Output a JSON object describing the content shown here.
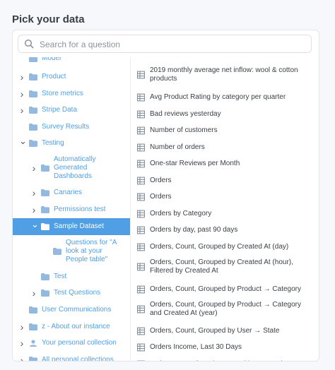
{
  "page": {
    "title": "Pick your data"
  },
  "search": {
    "placeholder": "Search for a question",
    "value": ""
  },
  "colors": {
    "accent": "#509ee3",
    "folder": "#94b9e0"
  },
  "sidebar": {
    "items": [
      {
        "label": "Model",
        "icon": "folder-icon",
        "chevron": ""
      },
      {
        "label": "Product",
        "icon": "folder-icon",
        "chevron": "right"
      },
      {
        "label": "Store metrics",
        "icon": "folder-icon",
        "chevron": "right"
      },
      {
        "label": "Stripe Data",
        "icon": "folder-icon",
        "chevron": "right"
      },
      {
        "label": "Survey Results",
        "icon": "folder-icon",
        "chevron": ""
      },
      {
        "label": "Testing",
        "icon": "folder-icon",
        "chevron": "down"
      },
      {
        "label": "Automatically Generated Dashboards",
        "icon": "folder-icon",
        "chevron": "right"
      },
      {
        "label": "Canaries",
        "icon": "folder-icon",
        "chevron": "right"
      },
      {
        "label": "Permissions test",
        "icon": "folder-icon",
        "chevron": "right"
      },
      {
        "label": "Sample Dataset",
        "icon": "folder-icon",
        "chevron": "down",
        "selected": true
      },
      {
        "label": "Questions for \"A look at your People table\"",
        "icon": "folder-icon",
        "chevron": ""
      },
      {
        "label": "Test",
        "icon": "folder-icon",
        "chevron": ""
      },
      {
        "label": "Test Questions",
        "icon": "folder-icon",
        "chevron": "right"
      },
      {
        "label": "User Communications",
        "icon": "folder-icon",
        "chevron": ""
      },
      {
        "label": "z - About our instance",
        "icon": "folder-icon",
        "chevron": "right"
      },
      {
        "label": "Your personal collection",
        "icon": "person-icon",
        "chevron": "right"
      },
      {
        "label": "All personal collections",
        "icon": "folder-icon",
        "chevron": "right"
      }
    ]
  },
  "questions": [
    "2019 monthly average net inflow: wool & cotton products",
    "Avg Product Rating by category per quarter",
    "Bad reviews yesterday",
    "Number of customers",
    "Number of orders",
    "One-star Reviews per Month",
    "Orders",
    "Orders",
    "Orders by Category",
    "Orders by day, past 90 days",
    "Orders, Count, Grouped by Created At (day)",
    "Orders, Count, Grouped by Created At (hour), Filtered by Created At",
    "Orders, Count, Grouped by Product → Category",
    "Orders, Count, Grouped by Product → Category and Created At (year)",
    "Orders, Count, Grouped by User → State",
    "Orders Income, Last 30 Days",
    "Orders, Sum of Total, Grouped by Created At"
  ]
}
